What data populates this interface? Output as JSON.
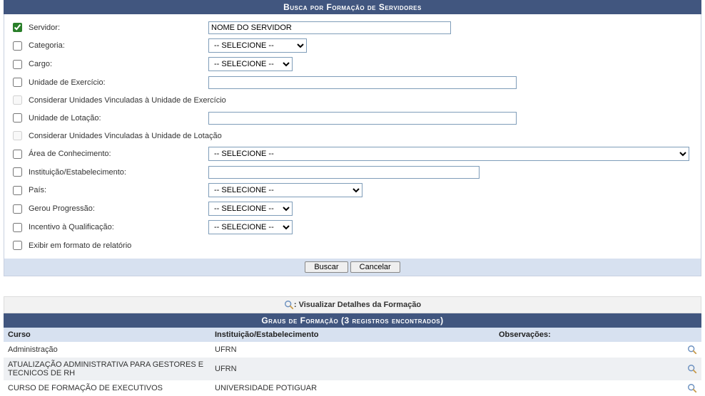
{
  "form": {
    "title": "Busca por Formação de Servidores",
    "rows": {
      "servidor_label": "Servidor:",
      "servidor_value": "NOME DO SERVIDOR",
      "categoria_label": "Categoria:",
      "categoria_value": "-- SELECIONE --",
      "cargo_label": "Cargo:",
      "cargo_value": "-- SELECIONE --",
      "unidade_exercicio_label": "Unidade de Exercício:",
      "considerar_exercicio_label": "Considerar Unidades Vinculadas à Unidade de Exercício",
      "unidade_lotacao_label": "Unidade de Lotação:",
      "considerar_lotacao_label": "Considerar Unidades Vinculadas à Unidade de Lotação",
      "area_label": "Área de Conhecimento:",
      "area_value": "-- SELECIONE --",
      "instituicao_label": "Instituição/Estabelecimento:",
      "pais_label": "País:",
      "pais_value": "-- SELECIONE --",
      "progressao_label": "Gerou Progressão:",
      "progressao_value": "-- SELECIONE --",
      "incentivo_label": "Incentivo à Qualificação:",
      "incentivo_value": "-- SELECIONE --",
      "relatorio_label": "Exibir em formato de relatório"
    },
    "buttons": {
      "buscar": "Buscar",
      "cancelar": "Cancelar"
    }
  },
  "info_bar": {
    "label": ": Visualizar Detalhes da Formação"
  },
  "results": {
    "title": "Graus de Formação (3 registros encontrados)",
    "columns": {
      "curso": "Curso",
      "inst": "Instituição/Estabelecimento",
      "obs": "Observações:"
    },
    "rows": [
      {
        "curso": "Administração",
        "inst": "UFRN",
        "obs": ""
      },
      {
        "curso": "ATUALIZAÇÃO ADMINISTRATIVA PARA GESTORES E TECNICOS DE RH",
        "inst": "UFRN",
        "obs": ""
      },
      {
        "curso": "CURSO DE FORMAÇÃO DE EXECUTIVOS",
        "inst": "UNIVERSIDADE POTIGUAR",
        "obs": ""
      }
    ]
  }
}
